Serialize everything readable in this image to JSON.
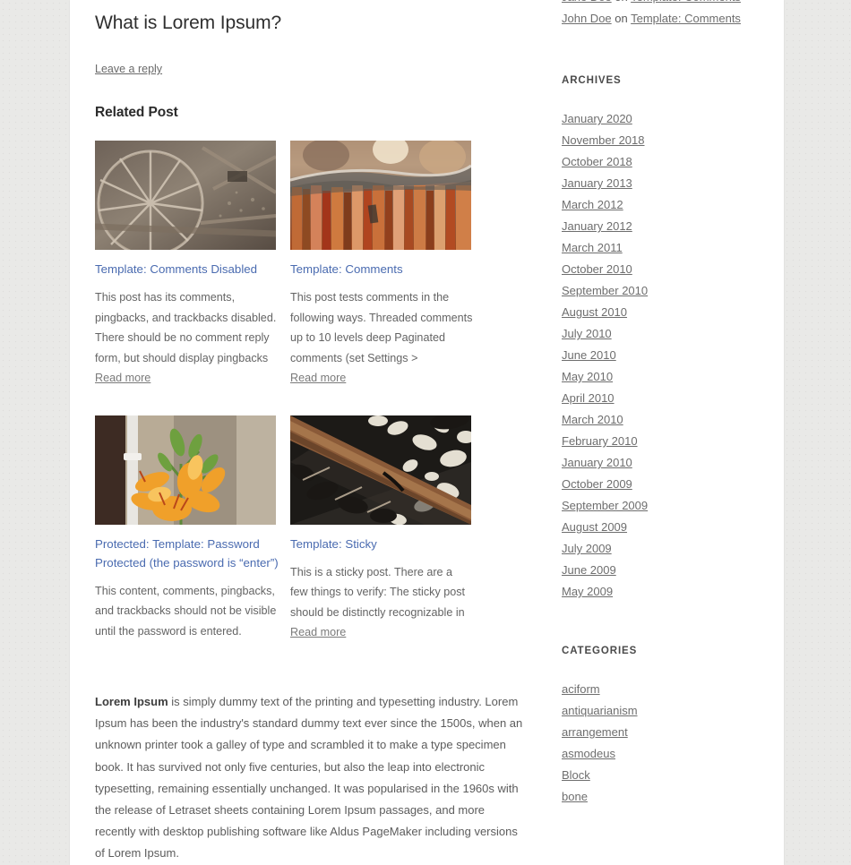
{
  "post": {
    "title": "What is Lorem Ipsum?",
    "leave_reply_label": "Leave a reply",
    "related_heading": "Related Post",
    "body_lead": "Lorem Ipsum",
    "body_text": " is simply dummy text of the printing and typesetting industry. Lorem Ipsum has been the industry's standard dummy text ever since the 1500s, when an unknown printer took a galley of type and scrambled it to make a type specimen book. It has survived not only five centuries, but also the leap into electronic typesetting, remaining essentially unchanged. It was popularised in the 1960s with the release of Letraset sheets containing Lorem Ipsum passages, and more recently with desktop publishing software like Aldus PageMaker including versions of Lorem Ipsum."
  },
  "related_posts": [
    {
      "title": "Template: Comments Disabled",
      "excerpt": "This post has its comments, pingbacks, and trackbacks disabled. There should be no comment reply form, but should display pingbacks ",
      "read_more": "Read more",
      "thumb_name": "wagon-wheel-photo"
    },
    {
      "title": "Template: Comments",
      "excerpt": "This post tests comments in the following ways. Threaded comments up to 10 levels deep Paginated comments (set Settings > ",
      "read_more": "Read more",
      "thumb_name": "rusted-metal-photo"
    },
    {
      "title": "Protected: Template: Password Protected (the password is “enter”)",
      "excerpt": "This content, comments, pingbacks, and trackbacks should not be visible until the password is entered.",
      "read_more": "",
      "thumb_name": "orange-lily-photo"
    },
    {
      "title": "Template: Sticky",
      "excerpt": "This is a sticky post. There are a few things to verify: The sticky post should be distinctly recognizable in ",
      "read_more": "Read more",
      "thumb_name": "rail-gravel-photo"
    }
  ],
  "sidebar": {
    "recent_comment": {
      "author": "John Doe",
      "connector": " on ",
      "post": "Template: Comments"
    },
    "archives": {
      "title": "Archives",
      "items": [
        "January 2020",
        "November 2018",
        "October 2018",
        "January 2013",
        "March 2012",
        "January 2012",
        "March 2011",
        "October 2010",
        "September 2010",
        "August 2010",
        "July 2010",
        "June 2010",
        "May 2010",
        "April 2010",
        "March 2010",
        "February 2010",
        "January 2010",
        "October 2009",
        "September 2009",
        "August 2009",
        "July 2009",
        "June 2009",
        "May 2009"
      ]
    },
    "categories": {
      "title": "Categories",
      "items": [
        "aciform",
        "antiquarianism",
        "arrangement",
        "asmodeus",
        "Block",
        "bone"
      ]
    }
  },
  "colors": {
    "link": "#4a6bb0",
    "meta_link": "#6e6e6e",
    "heading": "#2b2b2b",
    "page_bg": "#e9e9e7",
    "content_bg": "#ffffff"
  }
}
